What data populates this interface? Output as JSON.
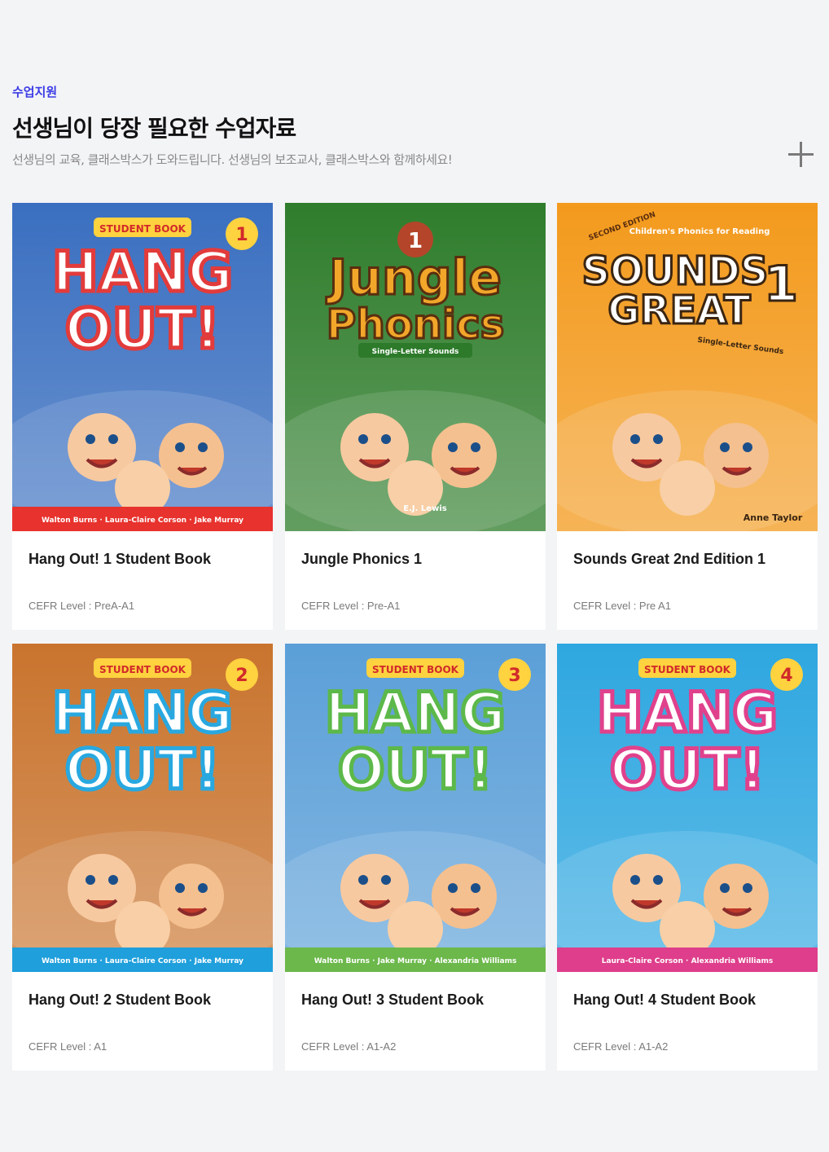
{
  "section": {
    "eyebrow": "수업지원",
    "title": "선생님이 당장 필요한 수업자료",
    "subtitle": "선생님의 교육, 클래스박스가 도와드립니다. 선생님의 보조교사, 클래스박스와 함께하세요!",
    "more_icon": "plus-icon"
  },
  "books": [
    {
      "title": "Hang Out! 1 Student Book",
      "level": "CEFR Level : PreA-A1",
      "cover": {
        "top": "STUDENT BOOK",
        "line1": "HANG",
        "line2": "OUT!",
        "number": "1",
        "authors": "Walton Burns · Laura-Claire Corson · Jake Murray",
        "bg": "#3a6fc0",
        "accent": "#e23b3b",
        "band": "#e8322d"
      }
    },
    {
      "title": "Jungle Phonics 1",
      "level": "CEFR Level : Pre-A1",
      "cover": {
        "top": "",
        "line1": "Jungle",
        "line2": "Phonics",
        "number": "1",
        "subtitle": "Single-Letter Sounds",
        "authors": "E.J. Lewis",
        "bg": "#2f7d2c",
        "accent": "#f2a62a",
        "band": "#1f5a20"
      }
    },
    {
      "title": "Sounds Great 2nd Edition 1",
      "level": "CEFR Level : Pre A1",
      "cover": {
        "top": "Children's Phonics for Reading",
        "line1": "SOUNDS",
        "line2": "GREAT",
        "number": "1",
        "subtitle": "Single-Letter Sounds",
        "edition": "SECOND EDITION",
        "authors": "Anne Taylor",
        "bg": "#f39a1d",
        "accent": "#ffffff",
        "band": "#e04a3a"
      }
    },
    {
      "title": "Hang Out! 2 Student Book",
      "level": "CEFR Level : A1",
      "cover": {
        "top": "STUDENT BOOK",
        "line1": "HANG",
        "line2": "OUT!",
        "number": "2",
        "authors": "Walton Burns · Laura-Claire Corson · Jake Murray",
        "bg": "#c9742e",
        "accent": "#29a8e0",
        "band": "#1f9fdc"
      }
    },
    {
      "title": "Hang Out! 3 Student Book",
      "level": "CEFR Level : A1-A2",
      "cover": {
        "top": "STUDENT BOOK",
        "line1": "HANG",
        "line2": "OUT!",
        "number": "3",
        "authors": "Walton Burns · Jake Murray · Alexandria Williams",
        "bg": "#5b9fd8",
        "accent": "#5cb84a",
        "band": "#6cb84b"
      }
    },
    {
      "title": "Hang Out! 4 Student Book",
      "level": "CEFR Level : A1-A2",
      "cover": {
        "top": "STUDENT BOOK",
        "line1": "HANG",
        "line2": "OUT!",
        "number": "4",
        "authors": "Laura-Claire Corson · Alexandria Williams",
        "bg": "#2ea7e0",
        "accent": "#e0418c",
        "band": "#de3e8b"
      }
    }
  ]
}
